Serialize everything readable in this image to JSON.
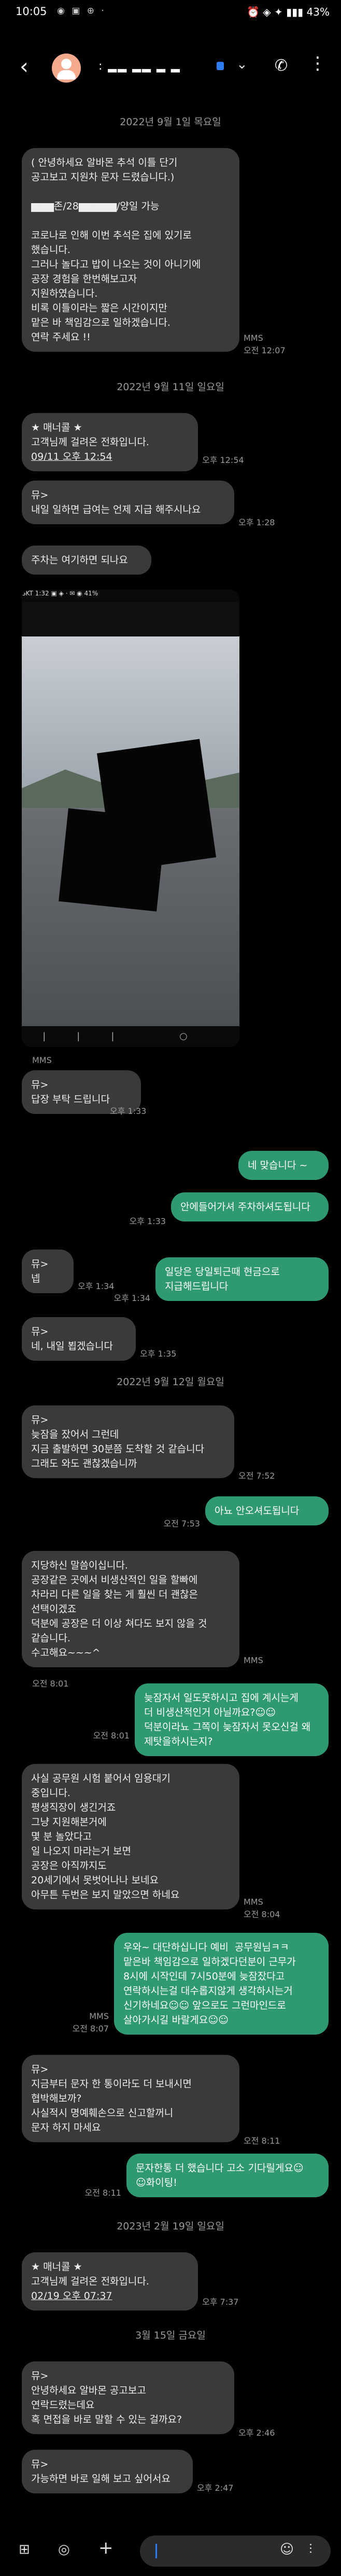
{
  "status": {
    "time": "10:05",
    "icons": "◉ ▣ ⊕ ·",
    "right": "⏰ ◈ ✦ ▮▮▮ 43%"
  },
  "header": {
    "back": "‹",
    "contact_name": ": ▂▂ ▂▂ ▂ ▂",
    "chevron": "⌄",
    "phone": "✆",
    "more": "⋮"
  },
  "dates": {
    "d1": "2022년 9월 1일 목요일",
    "d2": "2022년 9월 11일 일요일",
    "d3": "2022년 9월 12일 월요일",
    "d4": "2023년 2월 19일 일요일",
    "d5": "3월 15일 금요일"
  },
  "messages": {
    "m1": {
      "lines": [
        "( 안녕하세요 알바몬 추석 이틀 단기",
        "공고보고 지원차 문자 드렸습니다.)",
        "",
        "▆▆▆존/28▆▆▆▆▆/양일 가능",
        "",
        "코로나로 인해 이번 추석은 집에 있기로",
        "했습니다.",
        "그러나 놀다고 밥이 나오는 것이 아니기에",
        "공장 경험을 한번해보고자",
        "지원하였습니다.",
        "비록 이틀이라는 짧은 시간이지만",
        "맡은 바 책임감으로 일하겠습니다.",
        "연락 주세요 !!"
      ],
      "type": "MMS",
      "time": "오전 12:07"
    },
    "m2": {
      "lines": [
        "★ 매너콜 ★",
        "고객님께 걸려온 전화입니다.",
        "09/11 오후 12:54"
      ],
      "time": "오후 12:54"
    },
    "m3": {
      "lines": [
        "뮤>",
        "내일 일하면 급여는 언제 지급 해주시나요"
      ],
      "time": "오후 1:28"
    },
    "m4": {
      "lines": [
        "주차는 여기하면 되나요"
      ]
    },
    "m5": {
      "type": "MMS",
      "lines": [
        "뮤>",
        "답장 부탁 드립니다"
      ],
      "time": "오후 1:33"
    },
    "s1": {
      "lines": [
        "네 맞습니다 ~"
      ]
    },
    "s2": {
      "lines": [
        "안에들어가셔 주차하셔도됩니다"
      ],
      "time": "오후 1:33"
    },
    "m6": {
      "lines": [
        "뮤>",
        "넵"
      ],
      "time": "오후 1:34"
    },
    "s3": {
      "lines": [
        "일당은 당일퇴근때 현금으로",
        "지급해드립니다"
      ],
      "time": "오후 1:34"
    },
    "m7": {
      "lines": [
        "뮤>",
        "네, 내일 뵙겠습니다"
      ],
      "time": "오후 1:35"
    },
    "m8": {
      "lines": [
        "뮤>",
        "늦잠을 잤어서 그런데",
        "지금 출발하면 30분쯤 도착할 것 같습니다",
        "그래도 와도 괜찮겠습니까"
      ],
      "time": "오전 7:52"
    },
    "s4": {
      "lines": [
        "아뇨 안오셔도됩니다"
      ],
      "time": "오전 7:53"
    },
    "m9": {
      "lines": [
        "지당하신 말씀이십니다.",
        "공장같은 곳에서 비생산적인 일을 할빠에",
        "차라리 다른 일을 찾는 게 훨씬 더 괜찮은",
        "선택이겠죠",
        "덕분에 공장은 더 이상 쳐다도 보지 않을 것",
        "같습니다.",
        "수고해요~~~^"
      ],
      "type": "MMS",
      "time": "오전 8:01"
    },
    "s5": {
      "lines": [
        "늦잠자서 일도못하시고 집에 계시는게",
        "더 비생산적인거 아닐까요?☺☺",
        "덕분이라뇨 그쪽이 늦잠자서 못오신걸 왜",
        "제탓을하시는지?"
      ],
      "time": "오전 8:01"
    },
    "m10": {
      "lines": [
        "사실 공무원 시험 붙어서 임용대기",
        "중입니다.",
        "평생직장이 생긴거죠",
        "그냥 지원해본거에",
        "몇 분 놀았다고",
        "일 나오지 마라는거 보면",
        "공장은 아직까지도",
        "20세기에서 못벗어나나 보네요",
        "아무튼 두번은 보지 말았으면 하네요"
      ],
      "type": "MMS",
      "time": "오전 8:04"
    },
    "s6": {
      "lines": [
        "우와~ 대단하십니다 예비  공무원님ㅋㅋ",
        "맡은바 책임감으로 일하겠다던분이 근무가",
        "8시에 시작인데 7시50분에 늦잠잤다고",
        "연락하시는걸 대수롭지않게 생각하시는거",
        "신기하네요☺☺ 앞으로도 그런마인드로",
        "살아가시길 바랄게요☺☺"
      ]
    },
    "m11": {
      "type": "MMS",
      "time": "오전 8:07",
      "lines": [
        "뮤>",
        "지금부터 문자 한 통이라도 더 보내시면",
        "협박해보까?",
        "사실적시 명예훼손으로 신고할꺼니",
        "문자 하지 마세요"
      ],
      "time2": "오전 8:11"
    },
    "s7": {
      "lines": [
        "문자한통 더 했습니다 고소 기다릴게요☺",
        "☺화이팅!"
      ],
      "time": "오전 8:11"
    },
    "m12": {
      "lines": [
        "★ 매너콜 ★",
        "고객님께 걸려온 전화입니다.",
        "02/19 오후 07:37"
      ],
      "time": "오후 7:37"
    },
    "m13": {
      "lines": [
        "뮤>",
        "안녕하세요 알바몬 공고보고",
        "연락드렸는데요",
        "혹 면접을 바로 말할 수 있는 걸까요?"
      ],
      "time": "오후 2:46"
    },
    "m14": {
      "lines": [
        "뮤>",
        "가능하면 바로 일해 보고 싶어서요"
      ],
      "time": "오후 2:47"
    }
  },
  "photo": {
    "status": "SKT 1:32 ▣ ◈ ·                 ✉ ◉ 41%",
    "nav": "|||  ○  ‹"
  },
  "bottom": {
    "gallery_icon": "⊞",
    "camera_icon": "◎",
    "add_icon": "+",
    "emoji_icon": "☺",
    "voice_icon": "⫶"
  }
}
